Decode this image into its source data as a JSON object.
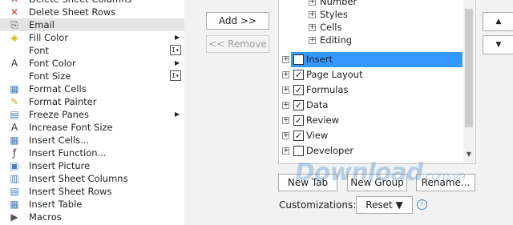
{
  "commands": [
    {
      "label": "Delete Sheet Columns",
      "icon": "delete-columns-icon",
      "glyph": "✕",
      "glyph_color": "#c0392b"
    },
    {
      "label": "Delete Sheet Rows",
      "icon": "delete-rows-icon",
      "glyph": "✕",
      "glyph_color": "#c0392b"
    },
    {
      "label": "Email",
      "icon": "paperclip-icon",
      "glyph": "⎘",
      "glyph_color": "#555555",
      "selected": true
    },
    {
      "label": "Fill Color",
      "icon": "fill-color-icon",
      "glyph": "◈",
      "glyph_color": "#d4b000",
      "arrow": true
    },
    {
      "label": "Font",
      "icon": "",
      "glyph": "",
      "combo": true
    },
    {
      "label": "Font Color",
      "icon": "font-color-icon",
      "glyph": "A",
      "glyph_color": "#333333",
      "arrow": true
    },
    {
      "label": "Font Size",
      "icon": "",
      "glyph": "",
      "combo": true
    },
    {
      "label": "Format Cells",
      "icon": "format-cells-icon",
      "glyph": "▦",
      "glyph_color": "#4a7ebb"
    },
    {
      "label": "Format Painter",
      "icon": "format-painter-icon",
      "glyph": "✎",
      "glyph_color": "#c9a227"
    },
    {
      "label": "Freeze Panes",
      "icon": "freeze-panes-icon",
      "glyph": "▤",
      "glyph_color": "#4a7ebb",
      "arrow": true
    },
    {
      "label": "Increase Font Size",
      "icon": "increase-font-size-icon",
      "glyph": "A",
      "glyph_color": "#333333"
    },
    {
      "label": "Insert Cells...",
      "icon": "insert-cells-icon",
      "glyph": "▦",
      "glyph_color": "#4a7ebb"
    },
    {
      "label": "Insert Function...",
      "icon": "function-icon",
      "glyph": "ƒ",
      "glyph_color": "#333333"
    },
    {
      "label": "Insert Picture",
      "icon": "picture-icon",
      "glyph": "▣",
      "glyph_color": "#4a7ebb"
    },
    {
      "label": "Insert Sheet Columns",
      "icon": "insert-columns-icon",
      "glyph": "▥",
      "glyph_color": "#4a7ebb"
    },
    {
      "label": "Insert Sheet Rows",
      "icon": "insert-rows-icon",
      "glyph": "▤",
      "glyph_color": "#4a7ebb"
    },
    {
      "label": "Insert Table",
      "icon": "table-icon",
      "glyph": "▦",
      "glyph_color": "#4a7ebb"
    },
    {
      "label": "Macros",
      "icon": "macros-icon",
      "glyph": "▶",
      "glyph_color": "#555555"
    }
  ],
  "buttons": {
    "add": "Add >>",
    "remove": "<< Remove",
    "new_tab": "New Tab",
    "new_group": "New Group",
    "rename": "Rename...",
    "reset": "Reset ▼"
  },
  "ribbon_tree": {
    "groups": [
      "Number",
      "Styles",
      "Cells",
      "Editing"
    ],
    "tabs": [
      {
        "label": "Insert",
        "checked": false,
        "selected": true
      },
      {
        "label": "Page Layout",
        "checked": true
      },
      {
        "label": "Formulas",
        "checked": true
      },
      {
        "label": "Data",
        "checked": true
      },
      {
        "label": "Review",
        "checked": true
      },
      {
        "label": "View",
        "checked": true
      },
      {
        "label": "Developer",
        "checked": false
      }
    ]
  },
  "customizations_label": "Customizations:",
  "watermark": {
    "main": "Download",
    "suffix": ".com.vn"
  },
  "colors": {
    "selection": "#3399ff",
    "selected_row": "#e4e4e4"
  }
}
